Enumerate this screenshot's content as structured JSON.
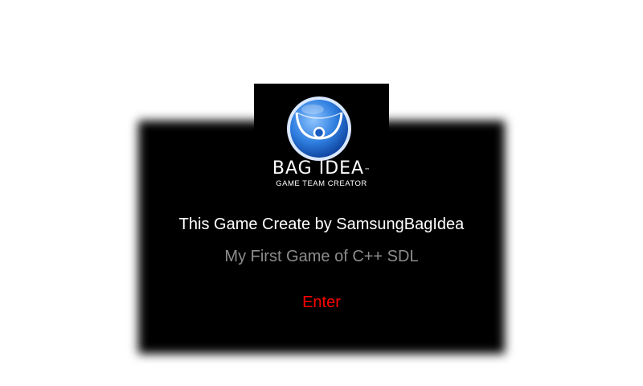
{
  "colors": {
    "background": "#ffffff",
    "panel": "#000000",
    "credit_text": "#ffffff",
    "subtitle_text": "#8c8c8c",
    "enter_text": "#ff0000",
    "logo_blue": "#2f7fe0"
  },
  "logo": {
    "icon": "bag-idea-logo-icon",
    "name": "BAG IDEA",
    "trademark": "™",
    "tagline": "GAME TEAM CREATOR"
  },
  "screen": {
    "credit": "This Game Create by SamsungBagIdea",
    "subtitle": "My First Game of C++ SDL",
    "enter_label": "Enter"
  }
}
